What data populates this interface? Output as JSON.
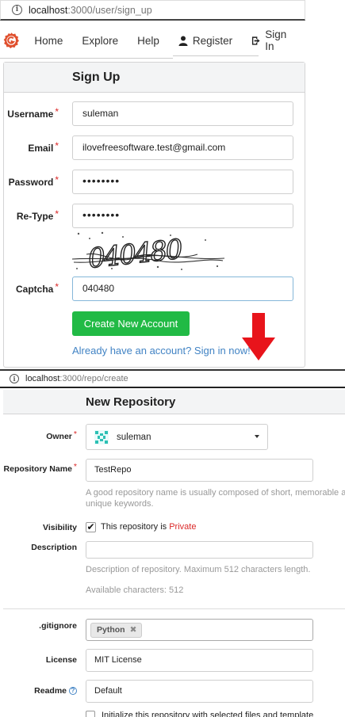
{
  "browser1": {
    "info_icon": "info-icon",
    "host": "localhost",
    "path": ":3000/user/sign_up"
  },
  "nav": {
    "items": [
      {
        "label": "Home"
      },
      {
        "label": "Explore"
      },
      {
        "label": "Help"
      },
      {
        "label": "Register",
        "icon": "person-icon"
      },
      {
        "label": "Sign In",
        "icon": "sign-in-icon"
      }
    ]
  },
  "signup": {
    "title": "Sign Up",
    "required_mark": "*",
    "username_label": "Username",
    "username_value": "suleman",
    "email_label": "Email",
    "email_value": "ilovefreesoftware.test@gmail.com",
    "password_label": "Password",
    "password_value": "••••••••",
    "retype_label": "Re-Type",
    "retype_value": "••••••••",
    "captcha_image_text": "040480",
    "captcha_label": "Captcha",
    "captcha_value": "040480",
    "create_button": "Create New Account",
    "signin_link": "Already have an account? Sign in now!"
  },
  "browser2": {
    "host": "localhost",
    "path": ":3000/repo/create"
  },
  "repo": {
    "title": "New Repository",
    "owner_label": "Owner",
    "owner_value": "suleman",
    "name_label": "Repository Name",
    "name_value": "TestRepo",
    "name_help_1": "A good repository name is usually composed of short, memorable and",
    "name_help_2": "unique keywords.",
    "visibility_label": "Visibility",
    "visibility_text": "This repository is ",
    "visibility_private": "Private",
    "check_mark": "✔",
    "description_label": "Description",
    "description_value": "",
    "description_help": "Description of repository. Maximum 512 characters length.",
    "available_chars": "Available characters: 512",
    "gitignore_label": ".gitignore",
    "gitignore_tag": "Python",
    "gitignore_remove": "✖",
    "license_label": "License",
    "license_value": "MIT License",
    "readme_label": "Readme",
    "readme_help_icon": "?",
    "readme_value": "Default",
    "init_text": "Initialize this repository with selected files and template"
  },
  "colors": {
    "accent_green": "#21ba45",
    "link_blue": "#4183c4",
    "required_red": "#db2828",
    "arrow_red": "#e8141b"
  }
}
